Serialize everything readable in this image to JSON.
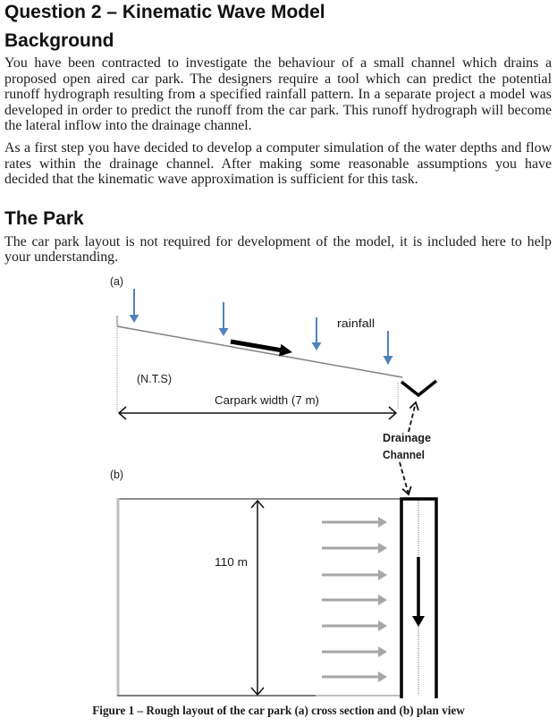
{
  "document": {
    "title": "Question 2 – Kinematic Wave Model",
    "sections": [
      {
        "heading": "Background",
        "paragraphs": [
          [
            "You have been contracted to investigate the behaviour of a small channel which drains a",
            "proposed open aired car park. The designers require a tool which can predict the potential",
            "runoff hydrograph resulting from a specified rainfall pattern. In a separate project a model was",
            "developed in order to predict the runoff from the car park. This runoff hydrograph will become",
            "the lateral inflow into the drainage channel."
          ],
          [
            "As a first step you have decided to develop a computer simulation of the water depths and flow",
            "rates within the drainage channel. After making some reasonable assumptions you have",
            "decided that the kinematic wave approximation is sufficient for this task."
          ]
        ]
      },
      {
        "heading": "The Park",
        "paragraphs": [
          [
            "The car park layout is not required for development of the model, it is included here to help",
            "your understanding."
          ]
        ]
      }
    ]
  },
  "figure": {
    "panel_a": {
      "label": "(a)",
      "rainfall_label": "rainfall",
      "scale_note": "(N.T.S)",
      "width_label": "Carpark width (7 m)",
      "channel_label": [
        "Drainage",
        "Channel"
      ]
    },
    "panel_b": {
      "label": "(b)",
      "length_label": "110 m"
    },
    "caption": "Figure 1 – Rough layout of the car park (a) cross section and (b) plan view",
    "colors": {
      "rain_arrow": "#4f81bd",
      "inflow_arrow": "#a6a6a6",
      "channel": "#000000"
    }
  }
}
